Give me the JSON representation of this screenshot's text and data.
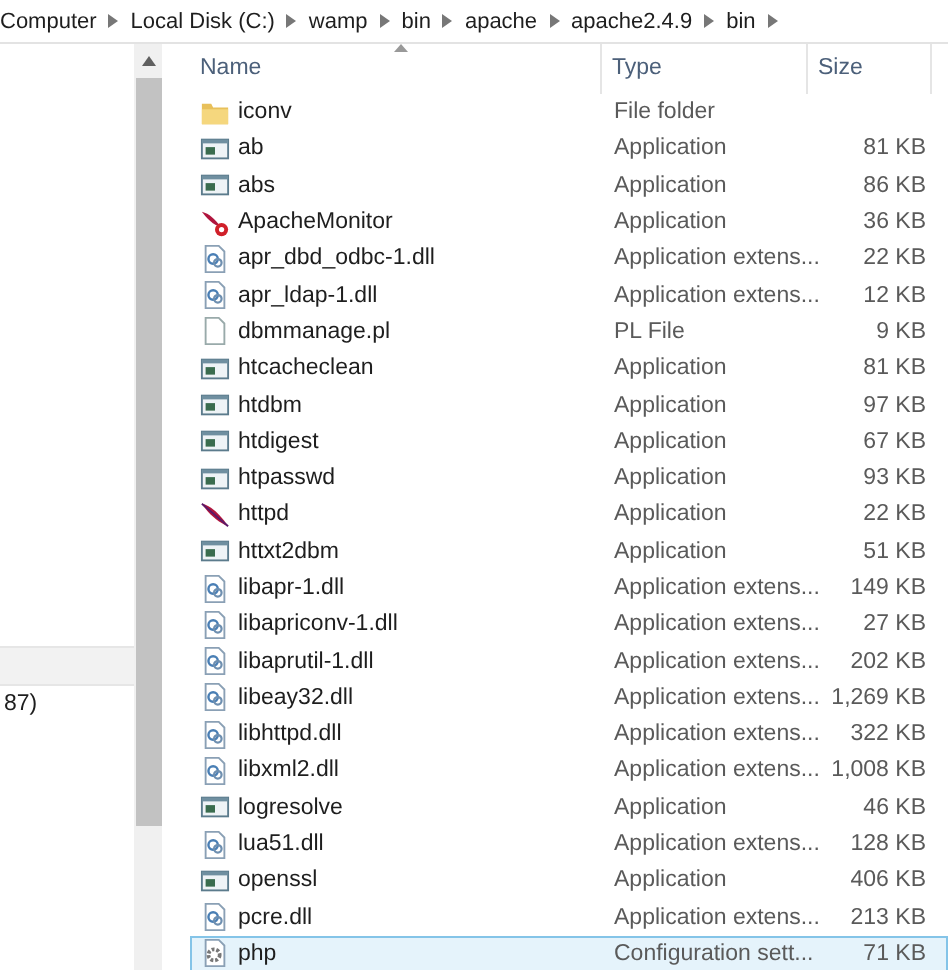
{
  "breadcrumb": [
    "Computer",
    "Local Disk (C:)",
    "wamp",
    "bin",
    "apache",
    "apache2.4.9",
    "bin"
  ],
  "nav_pane": {
    "items": [
      {
        "selected": true
      },
      {
        "label": "87)",
        "selected": false
      }
    ]
  },
  "table": {
    "columns": [
      "Name",
      "Type",
      "Size"
    ],
    "rows": [
      {
        "name": "iconv",
        "kind": "folder",
        "type": "File folder",
        "size": "",
        "selected": false
      },
      {
        "name": "ab",
        "kind": "app",
        "type": "Application",
        "size": "81 KB",
        "selected": false
      },
      {
        "name": "abs",
        "kind": "app",
        "type": "Application",
        "size": "86 KB",
        "selected": false
      },
      {
        "name": "ApacheMonitor",
        "kind": "monitor",
        "type": "Application",
        "size": "36 KB",
        "selected": false
      },
      {
        "name": "apr_dbd_odbc-1.dll",
        "kind": "dll",
        "type": "Application extens...",
        "size": "22 KB",
        "selected": false
      },
      {
        "name": "apr_ldap-1.dll",
        "kind": "dll",
        "type": "Application extens...",
        "size": "12 KB",
        "selected": false
      },
      {
        "name": "dbmmanage.pl",
        "kind": "file",
        "type": "PL File",
        "size": "9 KB",
        "selected": false
      },
      {
        "name": "htcacheclean",
        "kind": "app",
        "type": "Application",
        "size": "81 KB",
        "selected": false
      },
      {
        "name": "htdbm",
        "kind": "app",
        "type": "Application",
        "size": "97 KB",
        "selected": false
      },
      {
        "name": "htdigest",
        "kind": "app",
        "type": "Application",
        "size": "67 KB",
        "selected": false
      },
      {
        "name": "htpasswd",
        "kind": "app",
        "type": "Application",
        "size": "93 KB",
        "selected": false
      },
      {
        "name": "httpd",
        "kind": "feather",
        "type": "Application",
        "size": "22 KB",
        "selected": false
      },
      {
        "name": "httxt2dbm",
        "kind": "app",
        "type": "Application",
        "size": "51 KB",
        "selected": false
      },
      {
        "name": "libapr-1.dll",
        "kind": "dll",
        "type": "Application extens...",
        "size": "149 KB",
        "selected": false
      },
      {
        "name": "libapriconv-1.dll",
        "kind": "dll",
        "type": "Application extens...",
        "size": "27 KB",
        "selected": false
      },
      {
        "name": "libaprutil-1.dll",
        "kind": "dll",
        "type": "Application extens...",
        "size": "202 KB",
        "selected": false
      },
      {
        "name": "libeay32.dll",
        "kind": "dll",
        "type": "Application extens...",
        "size": "1,269 KB",
        "selected": false
      },
      {
        "name": "libhttpd.dll",
        "kind": "dll",
        "type": "Application extens...",
        "size": "322 KB",
        "selected": false
      },
      {
        "name": "libxml2.dll",
        "kind": "dll",
        "type": "Application extens...",
        "size": "1,008 KB",
        "selected": false
      },
      {
        "name": "logresolve",
        "kind": "app",
        "type": "Application",
        "size": "46 KB",
        "selected": false
      },
      {
        "name": "lua51.dll",
        "kind": "dll",
        "type": "Application extens...",
        "size": "128 KB",
        "selected": false
      },
      {
        "name": "openssl",
        "kind": "app",
        "type": "Application",
        "size": "406 KB",
        "selected": false
      },
      {
        "name": "pcre.dll",
        "kind": "dll",
        "type": "Application extens...",
        "size": "213 KB",
        "selected": false
      },
      {
        "name": "php",
        "kind": "config",
        "type": "Configuration sett...",
        "size": "71 KB",
        "selected": true
      }
    ]
  }
}
